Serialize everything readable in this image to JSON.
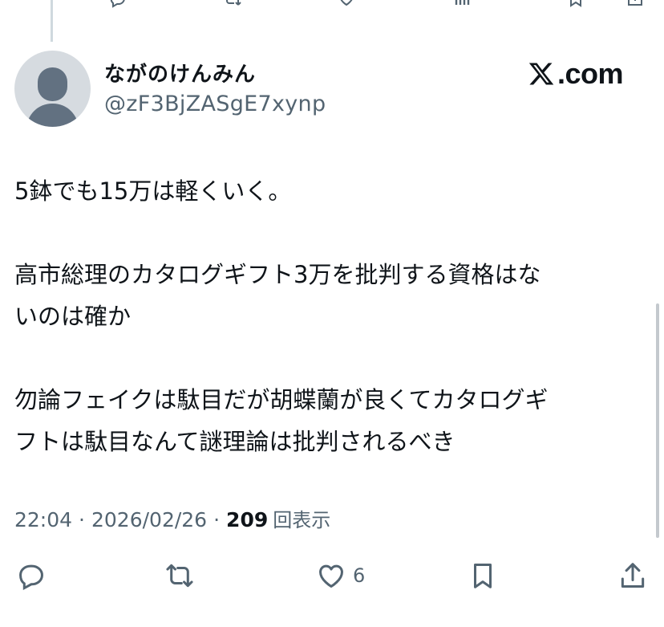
{
  "previous_tweet": {
    "actions": [
      {
        "icon": "reply-icon",
        "count": ""
      },
      {
        "icon": "retweet-icon",
        "count": ""
      },
      {
        "icon": "like-icon",
        "count": ""
      },
      {
        "icon": "views-icon",
        "count": ""
      },
      {
        "icon": "bookmark-icon",
        "count": ""
      },
      {
        "icon": "share-icon",
        "count": ""
      }
    ]
  },
  "tweet": {
    "author": {
      "display_name": "ながのけんみん",
      "handle": "@zF3BjZASgE7xynp"
    },
    "brand_label": ".com",
    "body_lines": [
      "5鉢でも15万は軽くいく。",
      "",
      "高市総理のカタログギフト3万を批判する資格はな",
      "いのは確か",
      "",
      "勿論フェイクは駄目だが胡蝶蘭が良くてカタログギ",
      "フトは駄目なんて謎理論は批判されるべき"
    ],
    "meta": {
      "time": "22:04",
      "separator": "·",
      "date": "2026/02/26",
      "views": "209",
      "views_label": "回表示"
    },
    "actions": {
      "reply": {
        "icon": "reply-icon"
      },
      "retweet": {
        "icon": "retweet-icon"
      },
      "like": {
        "icon": "like-icon",
        "count": "6"
      },
      "bookmark": {
        "icon": "bookmark-icon"
      },
      "share": {
        "icon": "share-icon"
      }
    }
  },
  "colors": {
    "text_primary": "#0f1419",
    "text_secondary": "#536471",
    "thread_line": "#cfd9de",
    "avatar_bg": "#d6dbe0",
    "avatar_fg": "#627181"
  }
}
